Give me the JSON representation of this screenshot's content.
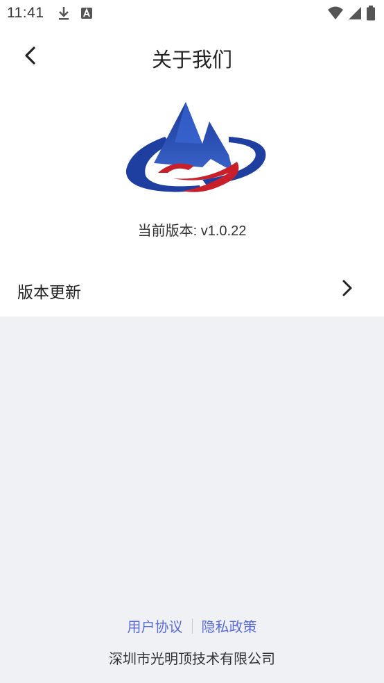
{
  "status_bar": {
    "time": "11:41",
    "icons_left": [
      "download-icon",
      "text-a-icon"
    ],
    "icons_right": [
      "wifi-icon",
      "signal-icon",
      "battery-icon"
    ]
  },
  "header": {
    "title": "关于我们",
    "back_icon": "chevron-left-icon"
  },
  "logo": {
    "icon": "mountain-logo",
    "colors": {
      "blue": "#1f3fa0",
      "red": "#c8202a"
    }
  },
  "version": {
    "text": "当前版本: v1.0.22"
  },
  "menu": {
    "update": {
      "label": "版本更新",
      "icon": "chevron-right-icon"
    }
  },
  "footer": {
    "user_agreement": "用户协议",
    "privacy_policy": "隐私政策",
    "company": "深圳市光明顶技术有限公司"
  },
  "colors": {
    "background": "#f0f1f5",
    "card": "#ffffff",
    "link": "#5b6bd6"
  }
}
